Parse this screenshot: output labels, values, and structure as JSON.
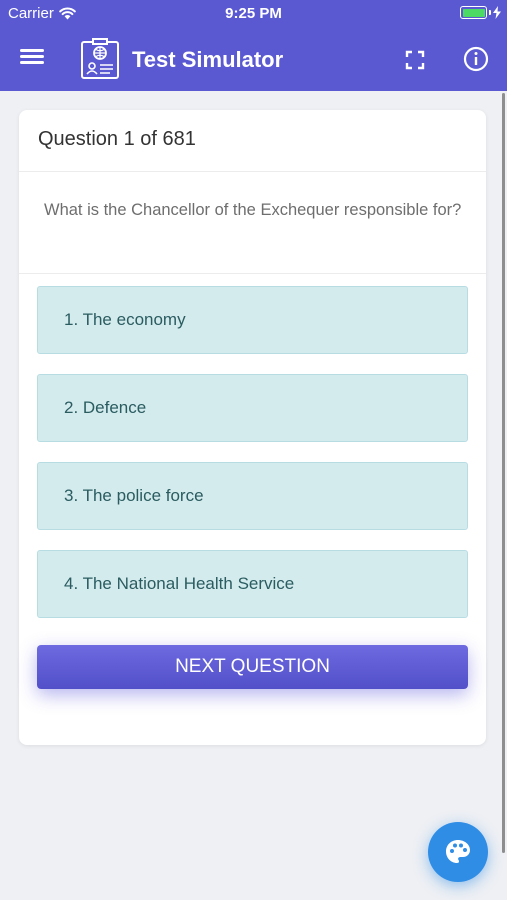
{
  "status_bar": {
    "carrier": "Carrier",
    "time": "9:25 PM"
  },
  "app_bar": {
    "title": "Test Simulator",
    "background_color": "#5a59d2"
  },
  "question": {
    "header": "Question 1 of 681",
    "text": "What is the Chancellor of the Exchequer responsible for?",
    "answers": [
      "1. The economy",
      "2. Defence",
      "3. The police force",
      "4. The National Health Service"
    ]
  },
  "actions": {
    "next_label": "NEXT QUESTION"
  },
  "icons": {
    "menu": "hamburger-menu-icon",
    "logo": "id-card-globe-icon",
    "fullscreen": "fullscreen-icon",
    "info": "info-icon",
    "fab": "palette-icon",
    "wifi": "wifi-icon",
    "battery": "battery-icon"
  },
  "colors": {
    "answer_bg": "#d4ebee",
    "answer_text": "#2a5c60",
    "fab": "#2f8de6"
  }
}
